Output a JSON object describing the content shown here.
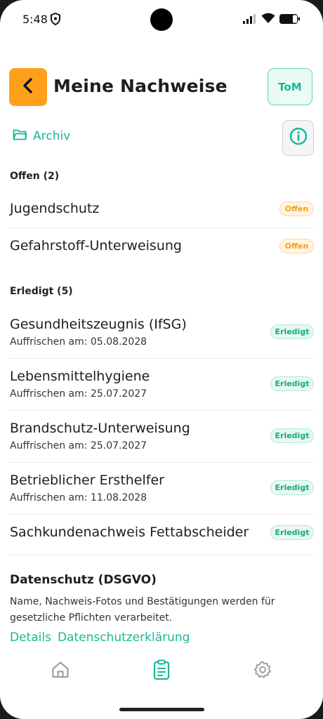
{
  "status": {
    "time": "5:48"
  },
  "header": {
    "title": "Meine Nachweise",
    "user_initials": "ToM"
  },
  "archive": {
    "label": "Archiv"
  },
  "open_section": {
    "label": "Offen (2)",
    "items": [
      {
        "name": "Jugendschutz",
        "badge": "Offen"
      },
      {
        "name": "Gefahrstoff-Unterweisung",
        "badge": "Offen"
      }
    ]
  },
  "done_section": {
    "label": "Erledigt (5)",
    "items": [
      {
        "name": "Gesundheitszeugnis (IfSG)",
        "sub": "Auffrischen am: 05.08.2028",
        "badge": "Erledigt"
      },
      {
        "name": "Lebensmittelhygiene",
        "sub": "Auffrischen am: 25.07.2027",
        "badge": "Erledigt"
      },
      {
        "name": "Brandschutz-Unterweisung",
        "sub": "Auffrischen am: 25.07.2027",
        "badge": "Erledigt"
      },
      {
        "name": "Betrieblicher Ersthelfer",
        "sub": "Auffrischen am: 11.08.2028",
        "badge": "Erledigt"
      },
      {
        "name": "Sachkundenachweis Fettabscheider",
        "badge": "Erledigt"
      }
    ]
  },
  "privacy": {
    "title": "Datenschutz (DSGVO)",
    "text": "Name, Nachweis-Fotos und Bestätigungen werden für gesetzliche Pflichten verarbeitet.",
    "link_details": "Details",
    "link_policy": "Datenschutzerklärung"
  },
  "nav": {
    "icons": [
      "home-icon",
      "clipboard-icon",
      "gear-icon"
    ],
    "active": "clipboard-icon"
  },
  "colors": {
    "accent": "#17b895",
    "back_button": "#ff9f1a",
    "open_badge": "#f0a020",
    "done_badge": "#17a884"
  }
}
